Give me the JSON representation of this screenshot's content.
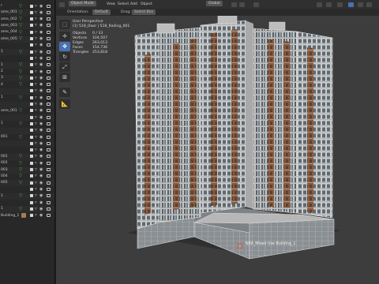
{
  "outliner": {
    "rows": [
      {
        "label": "r",
        "kind": "obj"
      },
      {
        "label": "ame_001",
        "kind": "obj"
      },
      {
        "label": "ame_002",
        "kind": "obj"
      },
      {
        "label": "ame_003",
        "kind": "obj"
      },
      {
        "label": "ame_004",
        "kind": "obj"
      },
      {
        "label": "ame_005",
        "kind": "obj"
      },
      {
        "label": "",
        "kind": "blank"
      },
      {
        "label": "1",
        "kind": "obj"
      },
      {
        "label": "",
        "kind": "blank"
      },
      {
        "label": "1",
        "kind": "obj"
      },
      {
        "label": "2",
        "kind": "obj"
      },
      {
        "label": "3",
        "kind": "obj"
      },
      {
        "label": "4",
        "kind": "obj"
      },
      {
        "label": "",
        "kind": "blank"
      },
      {
        "label": "1",
        "kind": "obj"
      },
      {
        "label": "",
        "kind": "blank"
      },
      {
        "label": "ame_001",
        "kind": "obj"
      },
      {
        "label": "",
        "kind": "blank"
      },
      {
        "label": "1",
        "kind": "obj"
      },
      {
        "label": "",
        "kind": "blank"
      },
      {
        "label": "001",
        "kind": "obj"
      },
      {
        "label": "",
        "kind": "blank"
      },
      {
        "label": "",
        "kind": "blank"
      },
      {
        "label": "001",
        "kind": "obj"
      },
      {
        "label": "002",
        "kind": "obj"
      },
      {
        "label": "003",
        "kind": "obj"
      },
      {
        "label": "004",
        "kind": "obj"
      },
      {
        "label": "005",
        "kind": "obj"
      },
      {
        "label": "",
        "kind": "blank"
      },
      {
        "label": "1",
        "kind": "obj"
      },
      {
        "label": "",
        "kind": "blank"
      },
      {
        "label": "1",
        "kind": "obj"
      },
      {
        "label": "Building_1",
        "kind": "coll"
      }
    ]
  },
  "header": {
    "mode": "Object Mode",
    "menus": [
      "View",
      "Select",
      "Add",
      "Object"
    ],
    "transform_orientation": "Global"
  },
  "subheader": {
    "orientation_label": "Orientation:",
    "orientation_value": "Default",
    "drag_label": "Drag:",
    "drag_value": "Select Box"
  },
  "stats": {
    "view": "User Perspective",
    "collection": "(1) 518_Door | 518_Railing_001",
    "rows": [
      {
        "label": "Objects",
        "value": "0 / 33"
      },
      {
        "label": "Vertices",
        "value": "104,507"
      },
      {
        "label": "Edges",
        "value": "263,013"
      },
      {
        "label": "Faces",
        "value": "154,736"
      },
      {
        "label": "Triangles",
        "value": "253,818"
      }
    ]
  },
  "tools": [
    {
      "icon": "select-box-icon",
      "glyph": "⬚",
      "active": false
    },
    {
      "icon": "cursor-icon",
      "glyph": "✛",
      "active": false
    },
    {
      "icon": "move-icon",
      "glyph": "✥",
      "active": true
    },
    {
      "icon": "rotate-icon",
      "glyph": "↻",
      "active": false
    },
    {
      "icon": "scale-icon",
      "glyph": "⤢",
      "active": false
    },
    {
      "icon": "transform-icon",
      "glyph": "⊞",
      "active": false
    },
    {
      "icon": "annotate-icon",
      "glyph": "✎",
      "active": false
    },
    {
      "icon": "measure-icon",
      "glyph": "📐",
      "active": false
    }
  ],
  "object_label": "NEA_Mixed Use Building_1",
  "colors": {
    "viewport_bg": "#3d3d3d",
    "facade": "#cfcfcf",
    "brick": "#8a5a3c",
    "glass": "#6c7880",
    "selection": "#4772b3"
  }
}
